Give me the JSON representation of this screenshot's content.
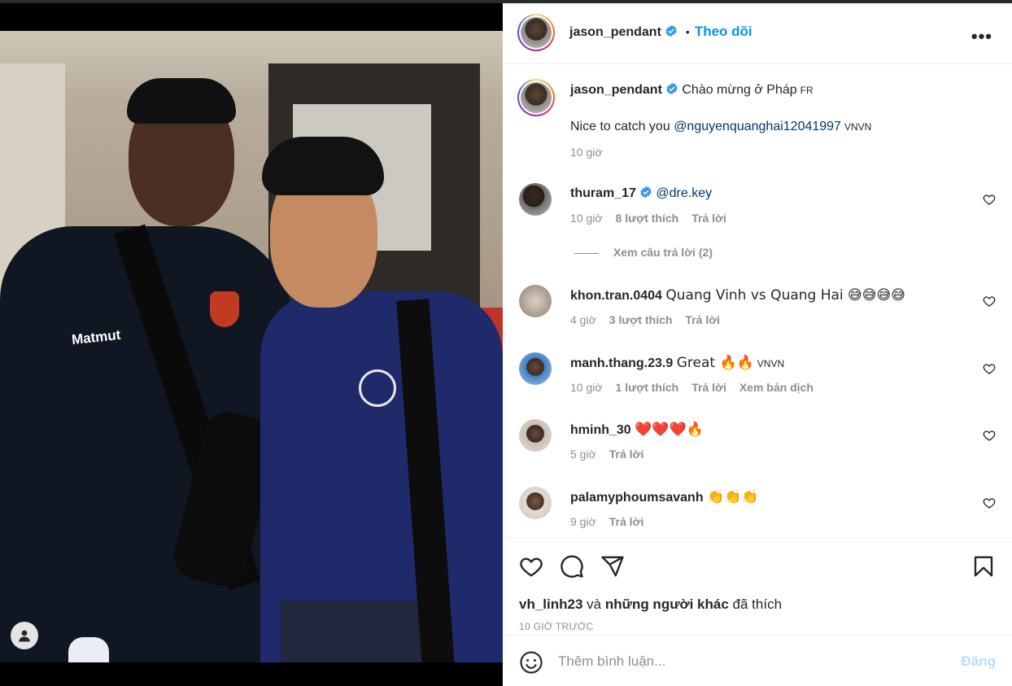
{
  "post": {
    "username": "jason_pendant",
    "follow_label": "Theo dõi",
    "more_label": "•••"
  },
  "caption": {
    "username": "jason_pendant",
    "text": "Chào mừng ở Pháp",
    "lang": "FR",
    "body_text": "Nice to catch you",
    "mention": "@nguyenquanghai12041997",
    "body_lang": "VNVN",
    "time": "10 giờ"
  },
  "comments": [
    {
      "username": "thuram_17",
      "verified": true,
      "text": "@dre.key",
      "time": "10 giờ",
      "likes": "8 lượt thích",
      "reply": "Trả lời"
    },
    {
      "username": "khon.tran.0404",
      "text": "Quang Vinh vs Quang Hai 😅😅😅😅",
      "time": "4 giờ",
      "likes": "3 lượt thích",
      "reply": "Trả lời"
    },
    {
      "username": "manh.thang.23.9",
      "text": "Great 🔥🔥",
      "lang": "VNVN",
      "time": "10 giờ",
      "likes": "1 lượt thích",
      "reply": "Trả lời",
      "translate": "Xem bản dịch"
    },
    {
      "username": "hminh_30",
      "text": "❤️❤️❤️🔥",
      "time": "5 giờ",
      "reply": "Trả lời"
    },
    {
      "username": "palamyphoumsavanh",
      "text": "👏👏👏",
      "time": "9 giờ",
      "reply": "Trả lời"
    }
  ],
  "view_replies": "Xem câu trả lời (2)",
  "photo": {
    "jacket_logo": "Matmut"
  },
  "likes_line": {
    "user": "vh_linh23",
    "and": "và",
    "others": "những người khác",
    "suffix": "đã thích"
  },
  "post_time": "10 GIỜ TRƯỚC",
  "compose": {
    "placeholder": "Thêm bình luận...",
    "post_label": "Đăng"
  },
  "colors": {
    "accent": "#0095f6",
    "verified": "#3897f0",
    "secondary_text": "#8e8e8e",
    "post_disabled": "#b2dffc"
  },
  "icons": [
    "heart-icon",
    "comment-icon",
    "share-icon",
    "bookmark-icon",
    "emoji-icon",
    "verified-icon",
    "more-icon",
    "user-icon"
  ]
}
